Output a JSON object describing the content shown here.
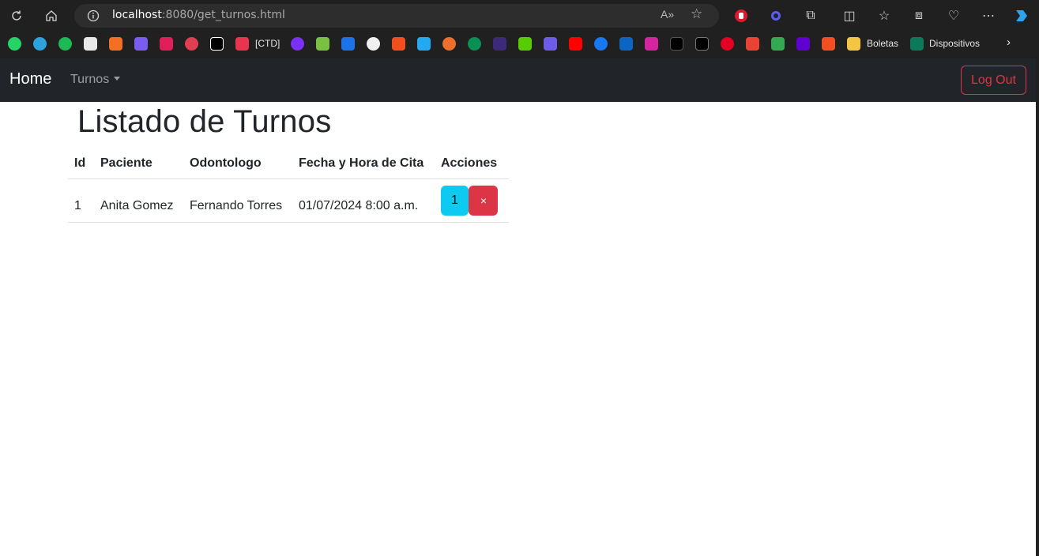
{
  "browser": {
    "url_host": "localhost",
    "url_path": ":8080/get_turnos.html",
    "bookmark_labels": [
      "[CTD]",
      "Boletas",
      "Dispositivos"
    ]
  },
  "navbar": {
    "brand": "Home",
    "dropdown_label": "Turnos",
    "logout_label": "Log Out"
  },
  "page": {
    "title": "Listado de Turnos"
  },
  "table": {
    "headers": [
      "Id",
      "Paciente",
      "Odontologo",
      "Fecha y Hora de Cita",
      "Acciones"
    ],
    "rows": [
      {
        "id": "1",
        "paciente": "Anita Gomez",
        "odontologo": "Fernando Torres",
        "fecha": "01/07/2024 8:00 a.m.",
        "edit_label": "1",
        "delete_label": "×"
      }
    ]
  },
  "colors": {
    "navbar_bg": "#212529",
    "edit_button": "#0dcaf0",
    "delete_button": "#dc3545"
  }
}
